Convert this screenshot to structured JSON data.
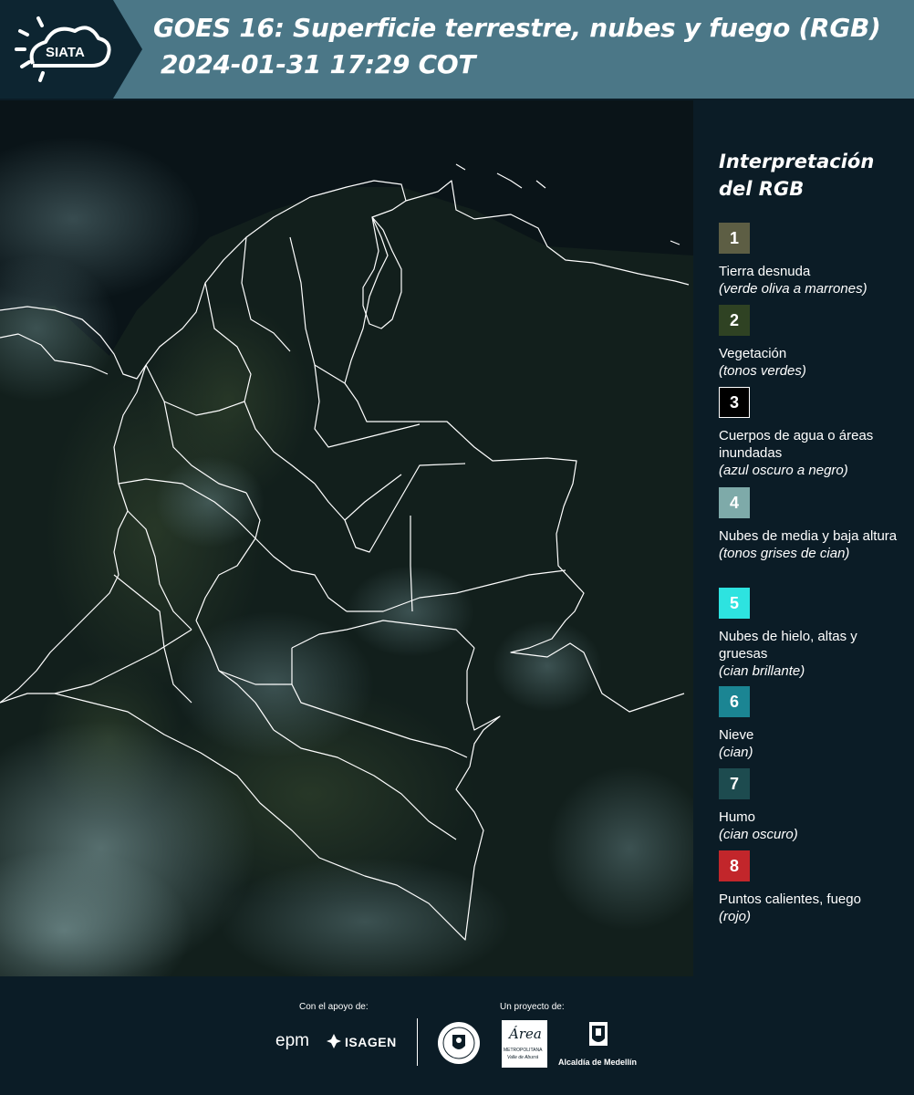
{
  "header": {
    "logo_text": "SIATA",
    "title_line1": "GOES 16: Superficie terrestre, nubes y fuego (RGB)",
    "title_line2": "2024-01-31 17:29 COT"
  },
  "legend": {
    "title": "Interpretación del RGB",
    "items": [
      {
        "number": "1",
        "label": "Tierra desnuda",
        "description": "(verde oliva a marrones)",
        "color": "#5d5e44"
      },
      {
        "number": "2",
        "label": "Vegetación",
        "description": "(tonos verdes)",
        "color": "#2f4223"
      },
      {
        "number": "3",
        "label": "Cuerpos de agua o áreas inundadas",
        "description": "(azul oscuro a negro)",
        "color": "#000000"
      },
      {
        "number": "4",
        "label": "Nubes de media y baja altura",
        "description": "(tonos grises de cian)",
        "color": "#7eaaa9"
      },
      {
        "number": "5",
        "label": "Nubes de hielo, altas y gruesas",
        "description": "(cian brillante)",
        "color": "#2de3e0"
      },
      {
        "number": "6",
        "label": "Nieve",
        "description": "(cian)",
        "color": "#1b8593"
      },
      {
        "number": "7",
        "label": "Humo",
        "description": "(cian oscuro)",
        "color": "#1d4b4f"
      },
      {
        "number": "8",
        "label": "Puntos calientes, fuego",
        "description": "(rojo)",
        "color": "#c2262b"
      }
    ]
  },
  "footer": {
    "support_label": "Con el apoyo de:",
    "project_label": "Un proyecto de:",
    "logos": {
      "epm": "epm",
      "isagen": "ISAGEN",
      "area_script": "Área",
      "area_name": "METROPOLITANA",
      "area_sub": "Valle de Aburrá",
      "alcaldia": "Alcaldía de Medellín"
    }
  },
  "colors": {
    "header_bg": "#4b7787",
    "logo_bg": "#0d2531",
    "page_bg": "#0b1c26",
    "map_bg": "#0a1418",
    "boundary": "#ffffff"
  }
}
